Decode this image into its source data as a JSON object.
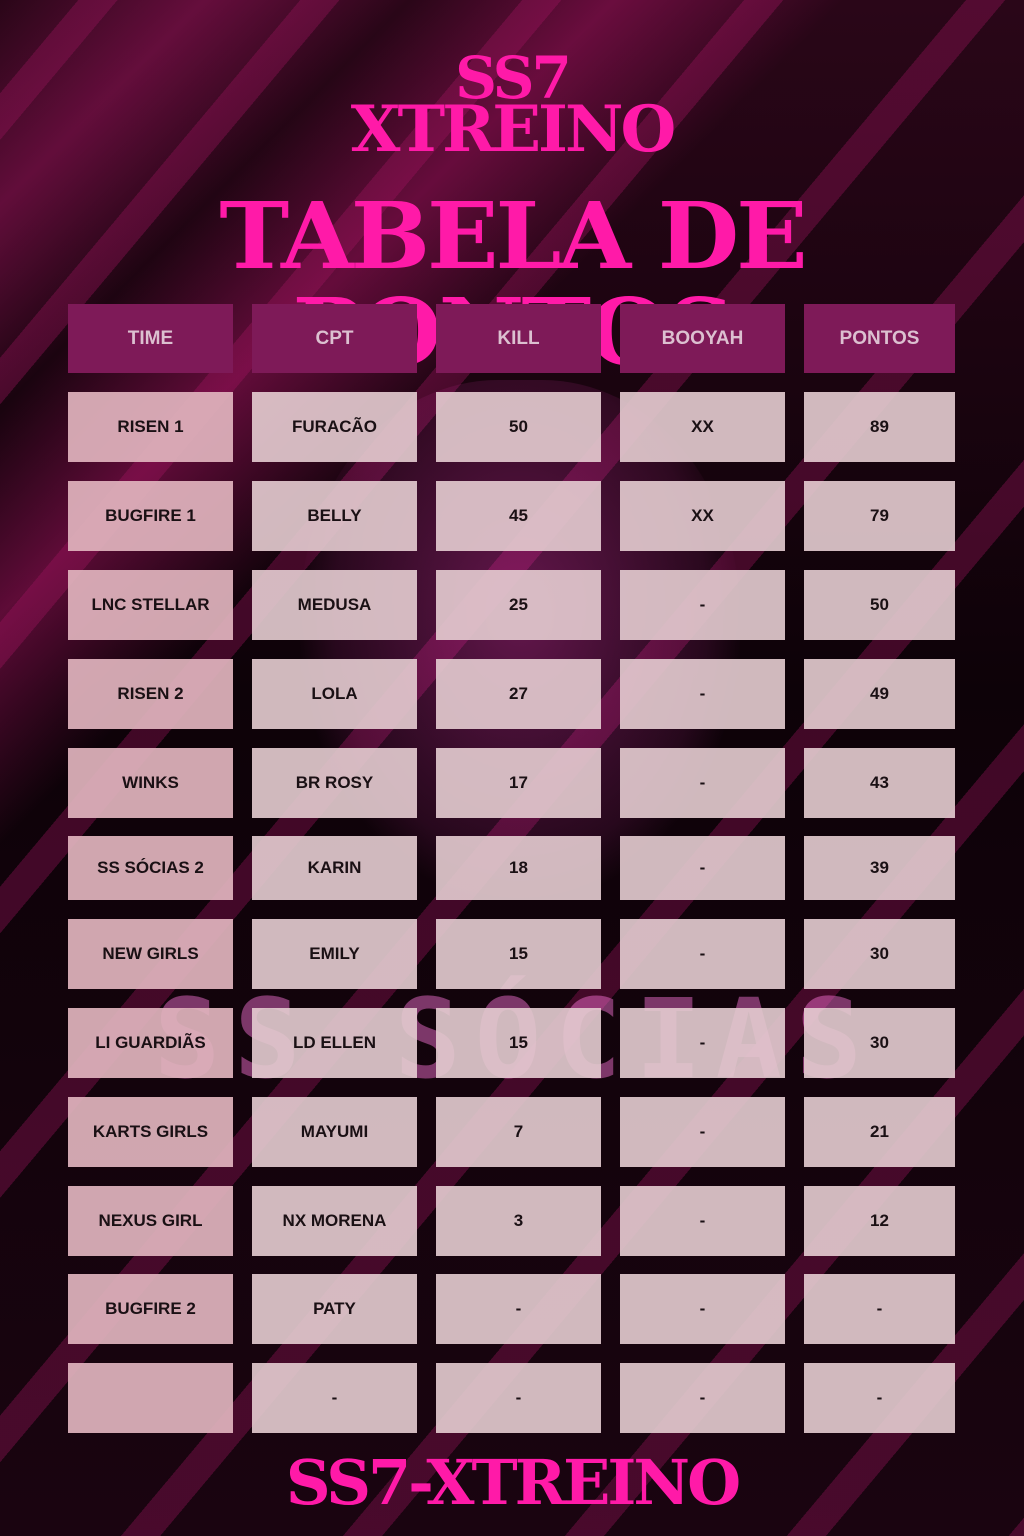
{
  "title_line1": "SS7",
  "title_line2": "XTREINO",
  "heading": "TABELA DE PONTOS",
  "footer": "SS7-XTREINO",
  "watermark_logo": "SS SÓCIAS",
  "accent_color": "#ff1aa8",
  "header_color": "#7e1a58",
  "columns": [
    "TIME",
    "CPT",
    "KILL",
    "BOOYAH",
    "PONTOS"
  ],
  "rows": [
    [
      "RISEN 1",
      "FURACÃO",
      "50",
      "XX",
      "89"
    ],
    [
      "BUGFIRE 1",
      "BELLY",
      "45",
      "XX",
      "79"
    ],
    [
      "LNC STELLAR",
      "MEDUSA",
      "25",
      "-",
      "50"
    ],
    [
      "RISEN 2",
      "LOLA",
      "27",
      "-",
      "49"
    ],
    [
      "WINKS",
      "BR ROSY",
      "17",
      "-",
      "43"
    ],
    [
      "SS SÓCIAS 2",
      "KARIN",
      "18",
      "-",
      "39"
    ],
    [
      "NEW GIRLS",
      "EMILY",
      "15",
      "-",
      "30"
    ],
    [
      "LI GUARDIÃS",
      "LD ELLEN",
      "15",
      "-",
      "30"
    ],
    [
      "KARTS GIRLS",
      "MAYUMI",
      "7",
      "-",
      "21"
    ],
    [
      "NEXUS GIRL",
      "NX MORENA",
      "3",
      "-",
      "12"
    ],
    [
      "BUGFIRE 2",
      "PATY",
      "-",
      "-",
      "-"
    ],
    [
      "",
      "-",
      "-",
      "-",
      "-"
    ]
  ]
}
